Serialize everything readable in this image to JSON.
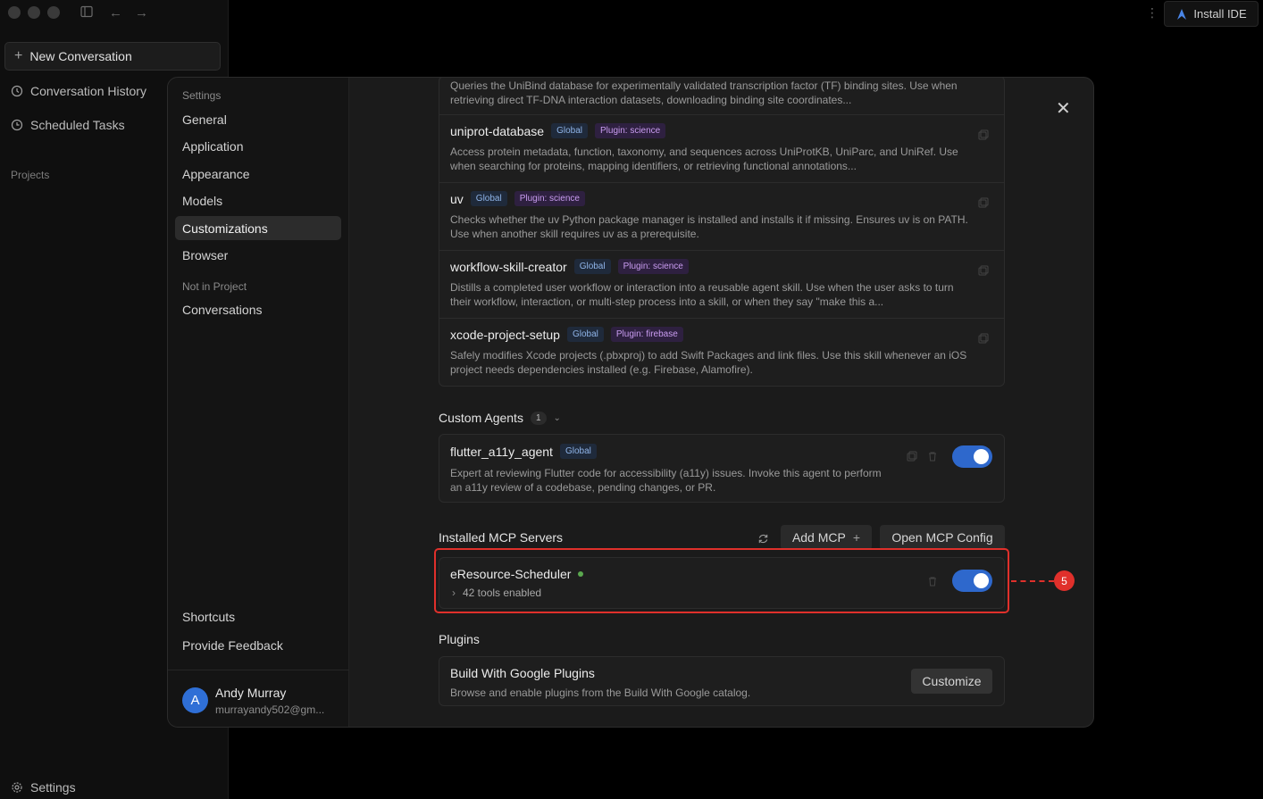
{
  "sidebar": {
    "new_conversation": "New Conversation",
    "conversation_history": "Conversation History",
    "scheduled_tasks": "Scheduled Tasks",
    "projects": "Projects",
    "settings": "Settings"
  },
  "header": {
    "install_ide": "Install IDE"
  },
  "settings_nav": {
    "section_label": "Settings",
    "items": [
      "General",
      "Application",
      "Appearance",
      "Models",
      "Customizations",
      "Browser"
    ],
    "active": "Customizations",
    "not_in_project_label": "Not in Project",
    "conversations": "Conversations",
    "shortcuts": "Shortcuts",
    "provide_feedback": "Provide Feedback",
    "user": {
      "initial": "A",
      "name": "Andy Murray",
      "email": "murrayandy502@gm..."
    }
  },
  "skills": [
    {
      "name": "",
      "description": "Queries the UniBind database for experimentally validated transcription factor (TF) binding sites. Use when retrieving direct TF-DNA interaction datasets, downloading binding site coordinates..."
    },
    {
      "name": "uniprot-database",
      "scope": "Global",
      "plugin": "Plugin: science",
      "description": "Access protein metadata, function, taxonomy, and sequences across UniProtKB, UniParc, and UniRef. Use when searching for proteins, mapping identifiers, or retrieving functional annotations..."
    },
    {
      "name": "uv",
      "scope": "Global",
      "plugin": "Plugin: science",
      "description": "Checks whether the uv Python package manager is installed and installs it if missing. Ensures uv is on PATH. Use when another skill requires uv as a prerequisite."
    },
    {
      "name": "workflow-skill-creator",
      "scope": "Global",
      "plugin": "Plugin: science",
      "description": "Distills a completed user workflow or interaction into a reusable agent skill. Use when the user asks to turn their workflow, interaction, or multi-step process into a skill, or when they say \"make this a..."
    },
    {
      "name": "xcode-project-setup",
      "scope": "Global",
      "plugin": "Plugin: firebase",
      "description": "Safely modifies Xcode projects (.pbxproj) to add Swift Packages and link files. Use this skill whenever an iOS project needs dependencies installed (e.g. Firebase, Alamofire)."
    }
  ],
  "custom_agents": {
    "title": "Custom Agents",
    "count": "1",
    "agent": {
      "name": "flutter_a11y_agent",
      "scope": "Global",
      "description": "Expert at reviewing Flutter code for accessibility (a11y) issues. Invoke this agent to perform an a11y review of a codebase, pending changes, or PR.",
      "enabled": true
    }
  },
  "mcp": {
    "title": "Installed MCP Servers",
    "add_label": "Add MCP",
    "open_config_label": "Open MCP Config",
    "server": {
      "name": "eResource-Scheduler",
      "tools": "42 tools enabled",
      "status_color": "#5aa84e",
      "enabled": true
    }
  },
  "plugins": {
    "title": "Plugins",
    "item": {
      "name": "Build With Google Plugins",
      "description": "Browse and enable plugins from the Build With Google catalog.",
      "button": "Customize"
    }
  },
  "annotation": {
    "marker": "5",
    "color": "#e0302b"
  }
}
